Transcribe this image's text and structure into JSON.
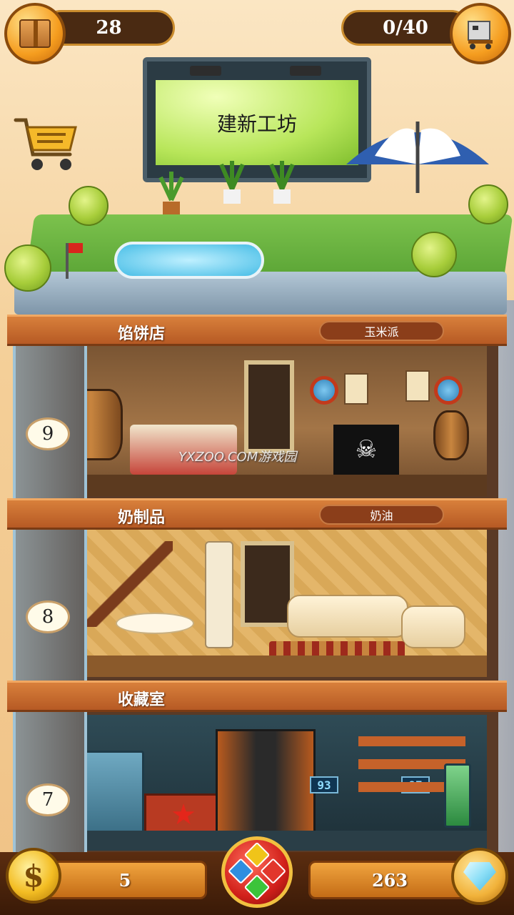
{
  "top_bar": {
    "boxes_count": "28",
    "delivery_count": "0/40"
  },
  "billboard": {
    "title": "建新工坊"
  },
  "floors": [
    {
      "number": "9",
      "name": "馅饼店",
      "product": "玉米派"
    },
    {
      "number": "8",
      "name": "奶制品",
      "product": "奶油"
    },
    {
      "number": "7",
      "name": "收藏室",
      "product": ""
    }
  ],
  "room_7_displays": [
    "93",
    "97"
  ],
  "watermark": "YXZOO.COM游戏园",
  "bottom_bar": {
    "coins": "5",
    "gems": "263",
    "coin_symbol": "$"
  },
  "icons": {
    "box": "box-icon",
    "delivery": "delivery-cart-icon",
    "shop": "shopping-cart-icon",
    "coin": "coin-icon",
    "gem": "diamond-icon",
    "menu": "menu-gems-icon"
  },
  "colors": {
    "band": "#c96a2b",
    "pill": "#4a2a12",
    "menu_red": "#d1201a"
  }
}
